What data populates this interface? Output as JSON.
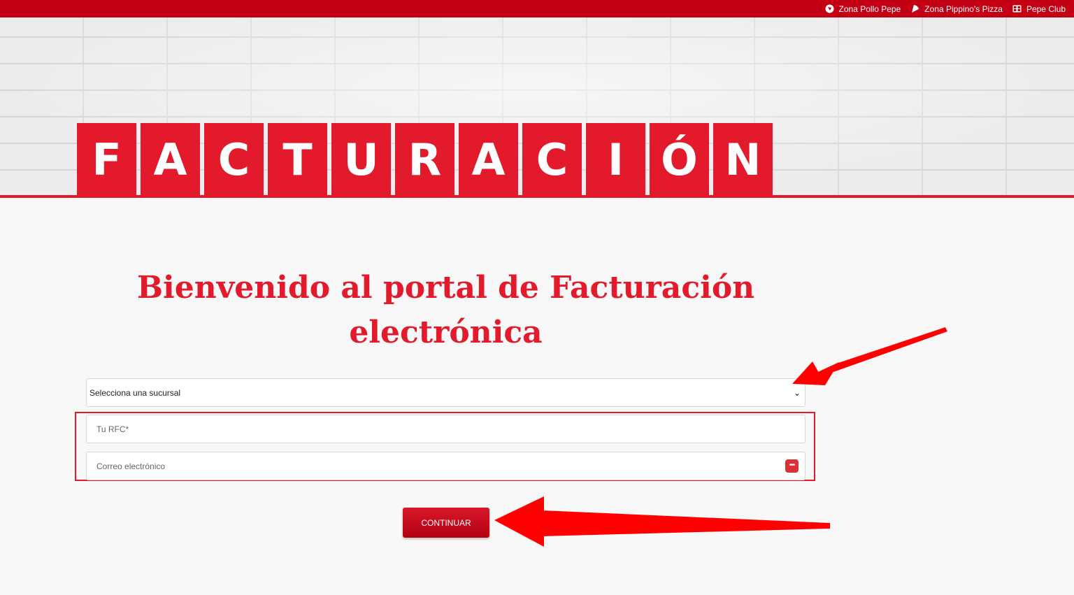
{
  "topbar": {
    "links": [
      {
        "label": "Zona Pollo Pepe",
        "icon": "chicken-icon"
      },
      {
        "label": "Zona Pippino's Pizza",
        "icon": "pizza-slice-icon"
      },
      {
        "label": "Pepe Club",
        "icon": "club-card-icon"
      }
    ]
  },
  "hero": {
    "letters": [
      "F",
      "A",
      "C",
      "T",
      "U",
      "R",
      "A",
      "C",
      "I",
      "Ó",
      "N"
    ]
  },
  "main": {
    "title_line1": "Bienvenido al portal de Facturación",
    "title_line2": "electrónica",
    "branch_select": {
      "selected": "Selecciona una sucursal"
    },
    "rfc_field": {
      "placeholder": "Tu RFC*",
      "value": ""
    },
    "email_field": {
      "placeholder": "Correo electrónico",
      "value": ""
    },
    "continue_label": "CONTINUAR"
  },
  "colors": {
    "brand_red": "#c40014",
    "accent_red": "#e21a2c",
    "annotation_red": "#ff0000"
  }
}
